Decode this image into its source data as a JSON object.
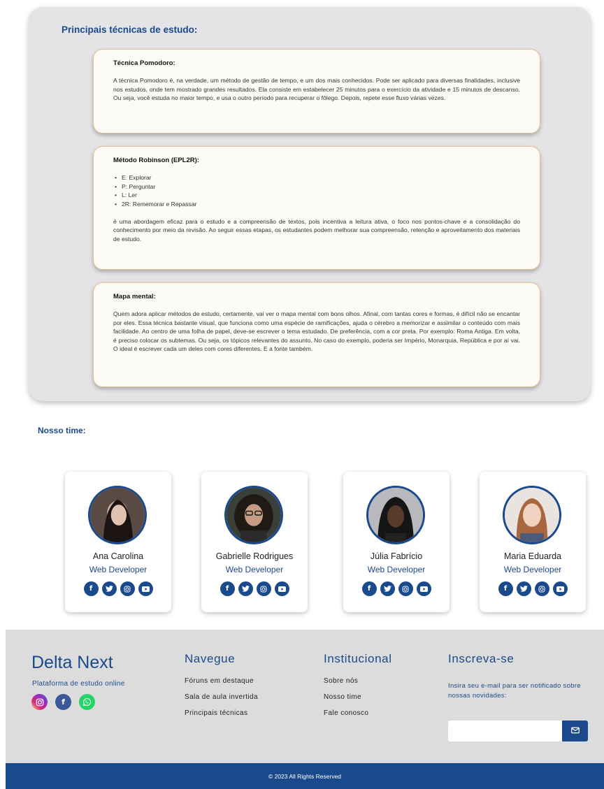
{
  "techniques": {
    "title": "Principais técnicas de estudo:",
    "pomodoro": {
      "heading": "Técnica Pomodoro:",
      "text": "A técnica Pomodoro é, na verdade, um método de gestão de tempo, e um dos mais conhecidos. Pode ser aplicado para diversas finalidades, inclusive nos estudos, onde tem mostrado grandes resultados. Ela consiste em estabelecer 25 minutos para o exercício da atividade e 15 minutos de descanso. Ou seja, você estuda no maior tempo, e usa o outro período para recuperar o fôlego. Depois, repete esse fluxo várias vezes."
    },
    "robinson": {
      "heading": "Método Robinson (EPL2R):",
      "items": [
        "E: Explorar",
        "P: Perguntar",
        "L: Ler",
        "2R: Rememorar e Repassar"
      ],
      "text": "é uma abordagem eficaz para o estudo e a compreensão de textos, pois incentiva a leitura ativa, o foco nos pontos-chave e a consolidação do conhecimento por meio da revisão. Ao seguir essas etapas, os estudantes podem melhorar sua compreensão, retenção e aproveitamento dos materiais de estudo."
    },
    "mindmap": {
      "heading": "Mapa mental:",
      "text": "Quem adora aplicar métodos de estudo, certamente, vai ver o mapa mental com bons olhos. Afinal, com tantas cores e formas, é difícil não se encantar por eles. Essa técnica bastante visual, que funciona como uma espécie de ramificações, ajuda o cérebro a memorizar e assimilar o conteúdo com mais facilidade. Ao centro de uma folha de papel, deve-se escrever o tema estudado. De preferência, com a cor preta. Por exemplo: Roma Antiga. Em volta, é preciso colocar os subtemas. Ou seja, os tópicos relevantes do assunto. No caso do exemplo, poderia ser Império, Monarquia, República e por aí vai. O ideal é escrever cada um deles com cores diferentes. E a fonte também."
    }
  },
  "team": {
    "title": "Nosso time:",
    "members": [
      {
        "name": "Ana Carolina",
        "role": "Web Developer"
      },
      {
        "name": "Gabrielle Rodrigues",
        "role": "Web Developer"
      },
      {
        "name": "Júlia Fabrício",
        "role": "Web Developer"
      },
      {
        "name": "Maria Eduarda",
        "role": "Web Developer"
      }
    ],
    "social_icons": [
      "facebook-icon",
      "twitter-icon",
      "instagram-icon",
      "youtube-icon"
    ]
  },
  "footer": {
    "brand": "Delta Next",
    "tagline": "Plataforma de estudo online",
    "social_icons": [
      "instagram-icon",
      "facebook-icon",
      "whatsapp-icon"
    ],
    "nav": {
      "title": "Navegue",
      "links": [
        "Fóruns em destaque",
        "Sala de aula invertida",
        "Principais técnicas"
      ]
    },
    "institutional": {
      "title": "Institucional",
      "links": [
        "Sobre nós",
        "Nosso time",
        "Fale conosco"
      ]
    },
    "subscribe": {
      "title": "Inscreva-se",
      "text": "Insira seu e-mail para ser notificado sobre nossas novidades:",
      "placeholder": "",
      "button_icon": "envelope-icon"
    },
    "copyright": "© 2023 All Rights Reserved"
  },
  "colors": {
    "primary": "#1a4a8c",
    "panel": "#e4e4e6",
    "card": "#fdfbf5",
    "card_border": "#e8c08c",
    "footer": "#dcdcdc",
    "instagram": "#d62976",
    "facebook": "#3b5998",
    "whatsapp": "#25d366"
  }
}
